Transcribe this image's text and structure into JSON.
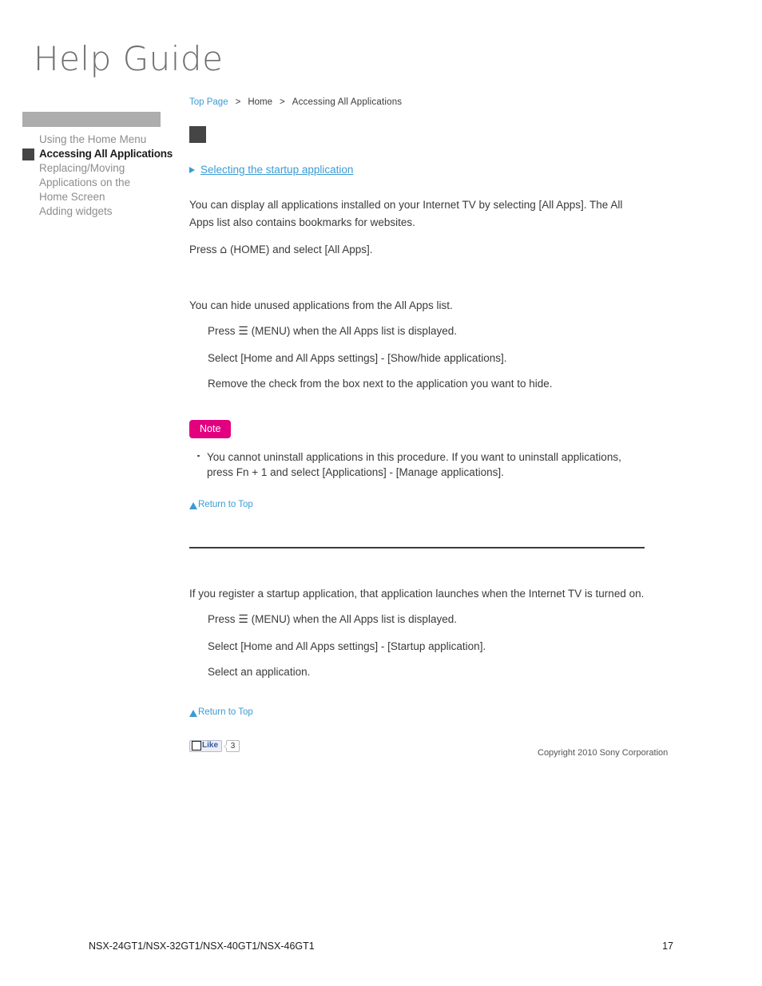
{
  "logo": {
    "text": "Help Guide"
  },
  "breadcrumb": {
    "top_page": "Top Page",
    "separator": ">",
    "home": "Home",
    "current": "Accessing All Applications"
  },
  "sidebar": {
    "header_label": "",
    "items": [
      {
        "label": "Using the Home Menu",
        "active": false
      },
      {
        "label": "Accessing All Applications",
        "active": true
      },
      {
        "label": "Replacing/Moving Applications on the Home Screen",
        "active": false
      },
      {
        "label": "Adding widgets",
        "active": false
      }
    ]
  },
  "main": {
    "jump_link": "Selecting the startup application",
    "intro_paragraph": "You can display all applications installed on your Internet TV by selecting [All Apps]. The All Apps list also contains bookmarks for websites.",
    "press_home_before": "Press",
    "home_glyph": "⌂",
    "press_home_after": "(HOME) and select [All Apps].",
    "hide_intro": "You can hide unused applications from the All Apps list.",
    "menu_glyph": "☰",
    "hide_steps": [
      {
        "before": "Press",
        "glyph": "☰",
        "after": "(MENU) when the All Apps list is displayed."
      },
      {
        "before": "",
        "glyph": "",
        "after": "Select [Home and All Apps settings] - [Show/hide applications]."
      },
      {
        "before": "",
        "glyph": "",
        "after": "Remove the check from the box next to the application you want to hide."
      }
    ],
    "note_badge": "Note",
    "note_items": [
      "You cannot uninstall applications in this procedure. If you want to uninstall applications, press Fn + 1 and select [Applications] - [Manage applications]."
    ],
    "return_to_top": "Return to Top",
    "startup_intro": "If you register a startup application, that application launches when the Internet TV is turned on.",
    "startup_steps": [
      {
        "before": "Press",
        "glyph": "☰",
        "after": "(MENU) when the All Apps list is displayed."
      },
      {
        "before": "",
        "glyph": "",
        "after": "Select [Home and All Apps settings] - [Startup application]."
      },
      {
        "before": "",
        "glyph": "",
        "after": "Select an application."
      }
    ],
    "return_to_top_2": "Return to Top"
  },
  "like_widget": {
    "label": "Like",
    "count": "3"
  },
  "copyright": "Copyright 2010 Sony Corporation",
  "page_footer": {
    "models": "NSX-24GT1/NSX-32GT1/NSX-40GT1/NSX-46GT1",
    "page_number": "17"
  },
  "colors": {
    "link_blue": "#3b9bd4",
    "note_pink": "#e2007f",
    "sidebar_header_gray": "#adadad",
    "marker_dark": "#454545",
    "like_blue": "#3b5998"
  }
}
